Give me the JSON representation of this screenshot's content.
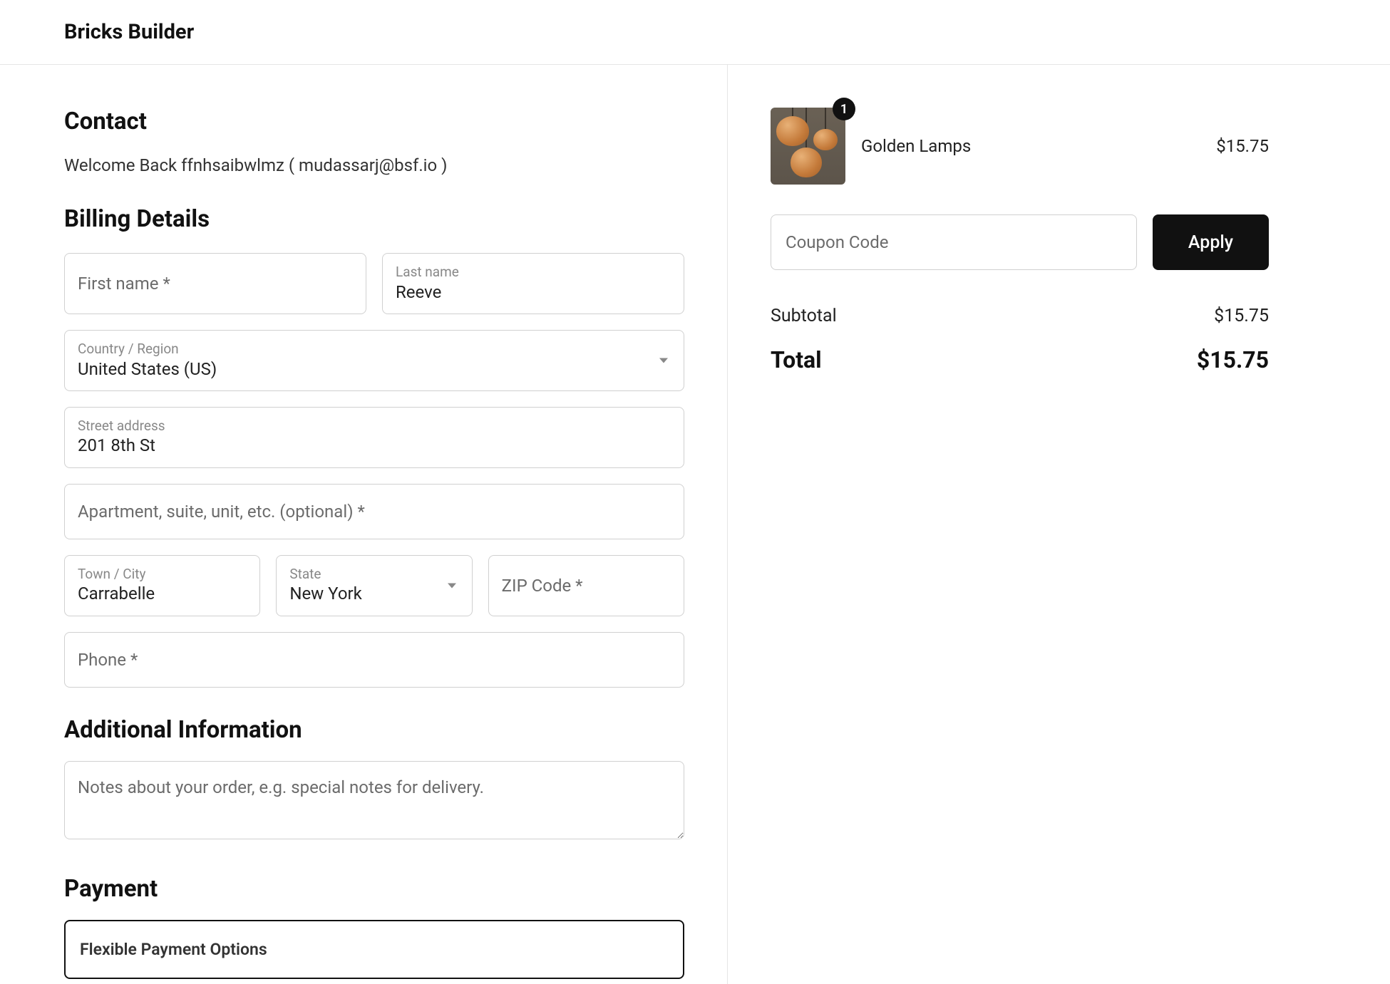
{
  "brand": "Bricks Builder",
  "contact": {
    "heading": "Contact",
    "welcome": "Welcome Back ffnhsaibwlmz ( mudassarj@bsf.io )"
  },
  "billing": {
    "heading": "Billing Details",
    "first_name": {
      "label": "First name *",
      "value": ""
    },
    "last_name": {
      "label": "Last name",
      "value": "Reeve"
    },
    "country": {
      "label": "Country / Region",
      "value": "United States (US)"
    },
    "street": {
      "label": "Street address",
      "value": "201 8th St"
    },
    "apt": {
      "label": "Apartment, suite, unit, etc. (optional) *",
      "value": ""
    },
    "city": {
      "label": "Town / City",
      "value": "Carrabelle"
    },
    "state": {
      "label": "State",
      "value": "New York"
    },
    "zip": {
      "label": "ZIP Code *",
      "value": ""
    },
    "phone": {
      "label": "Phone *",
      "value": ""
    }
  },
  "additional": {
    "heading": "Additional Information",
    "notes_placeholder": "Notes about your order, e.g. special notes for delivery."
  },
  "payment": {
    "heading": "Payment",
    "option": "Flexible Payment Options"
  },
  "cart": {
    "item": {
      "name": "Golden Lamps",
      "qty": "1",
      "price": "$15.75"
    },
    "coupon_placeholder": "Coupon Code",
    "apply_label": "Apply",
    "subtotal_label": "Subtotal",
    "subtotal": "$15.75",
    "total_label": "Total",
    "total": "$15.75"
  }
}
